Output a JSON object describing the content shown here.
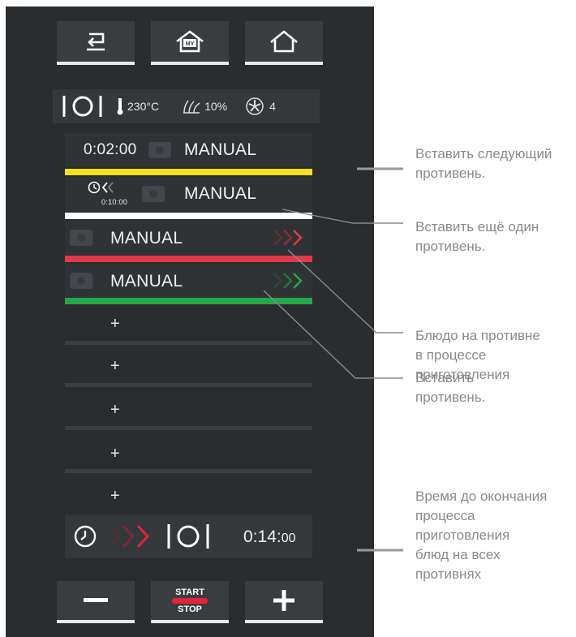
{
  "info": {
    "temperature": "230°C",
    "humidity": "10%",
    "fan": "4"
  },
  "trays": [
    {
      "time": "0:02:00",
      "label": "MANUAL"
    },
    {
      "timer": "0:10:00",
      "label": "MANUAL"
    },
    {
      "label": "MANUAL"
    },
    {
      "label": "MANUAL"
    }
  ],
  "empty_slots": [
    "+",
    "+",
    "+",
    "+",
    "+"
  ],
  "colors": {
    "yellow": "#f6e01d",
    "white": "#ffffff",
    "red": "#e23a4a",
    "green": "#25a84a",
    "panel": "#2a2c2e"
  },
  "total": {
    "time_main": "0:14:",
    "time_sec": "00"
  },
  "controls": {
    "start": "START",
    "stop": "STOP"
  },
  "annotations": [
    [
      "Вставить следующий",
      "противень."
    ],
    [
      "Вставить ещё один",
      "противень."
    ],
    [
      "Блюдо на противне",
      "в процессе",
      "приготовления"
    ],
    [
      "Вставить",
      "противень."
    ],
    [
      "Время до окончания",
      "процесса",
      "приготовления",
      "блюд на всех",
      "противнях"
    ]
  ],
  "icons": [
    "back-icon",
    "my-home-icon",
    "home-icon",
    "plate-icon",
    "thermometer-icon",
    "steam-icon",
    "fan-icon",
    "camera-icon",
    "clock-icon",
    "chevron-icon",
    "minus-icon",
    "plus-icon"
  ]
}
